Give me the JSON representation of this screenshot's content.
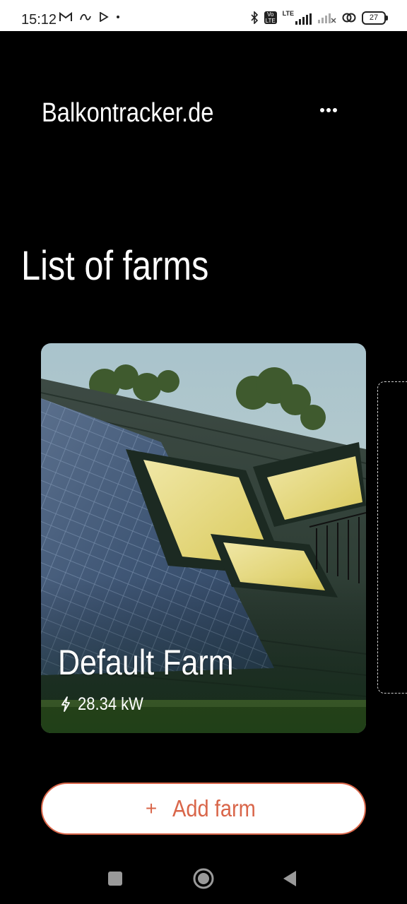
{
  "status_bar": {
    "time": "15:12",
    "network_type": "LTE",
    "volte_line1": "Vo",
    "volte_line2": "LTE",
    "battery_level": "27",
    "left_icons": [
      "gmail-icon",
      "app-notification-icon",
      "play-store-icon",
      "dot-icon"
    ],
    "right_icons": [
      "bluetooth-icon",
      "volte-icon",
      "lte-signal-icon",
      "signal-empty-icon",
      "hotspot-link-icon",
      "battery-icon"
    ]
  },
  "header": {
    "app_title": "Balkontracker.de",
    "menu_icon": "more-horizontal-icon"
  },
  "main": {
    "heading": "List of farms",
    "farms": [
      {
        "name": "Default Farm",
        "power": "28.34 kW",
        "power_icon": "lightning-bolt-icon",
        "image": "solar-roof-photo"
      }
    ],
    "add_farm": {
      "icon": "+",
      "label": "Add farm",
      "accent_color": "#d9664a"
    }
  },
  "nav_bar": {
    "buttons": [
      "recents-square-icon",
      "home-circle-icon",
      "back-triangle-icon"
    ]
  }
}
